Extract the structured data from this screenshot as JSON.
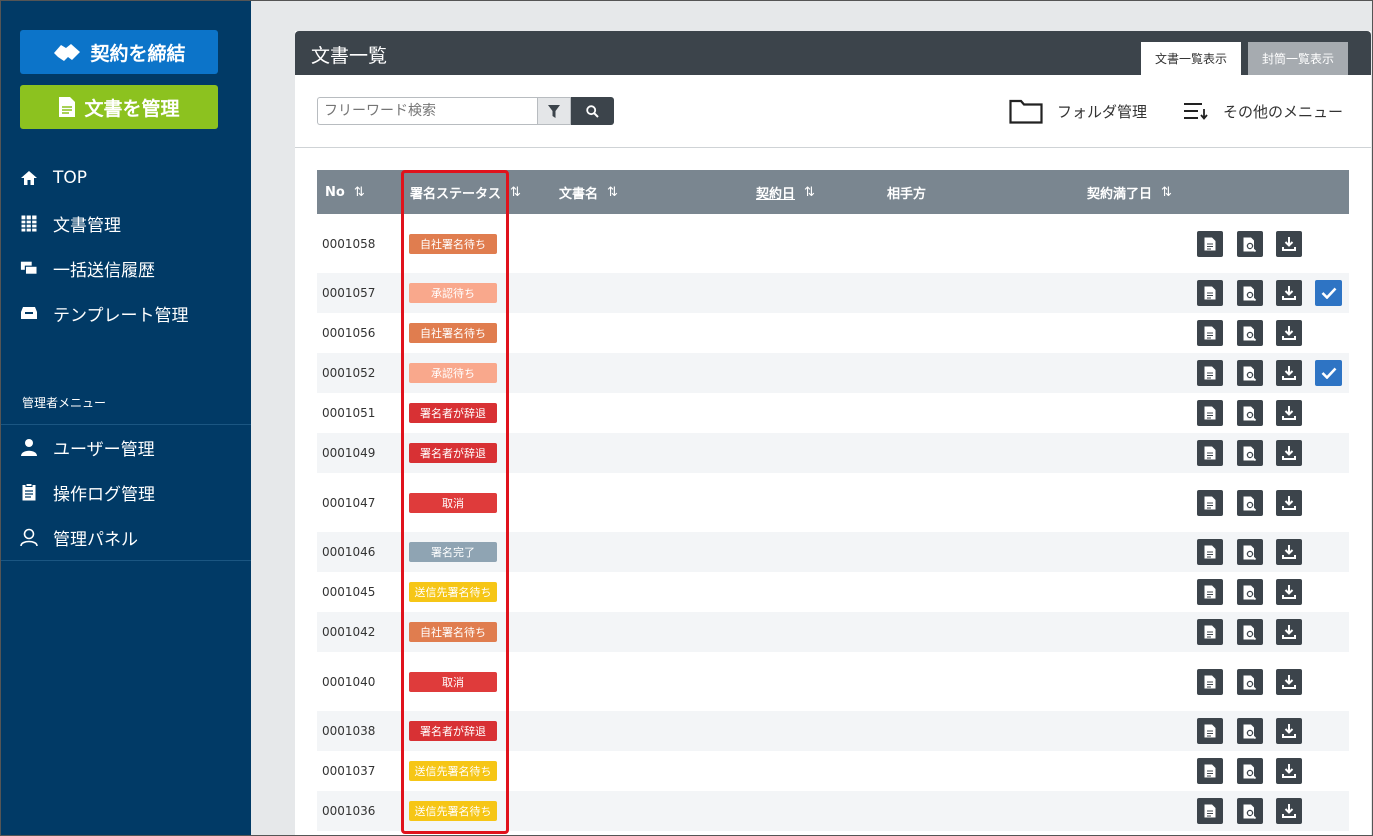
{
  "sidebar": {
    "contract_button": "契約を締結",
    "manage_button": "文書を管理",
    "nav": [
      {
        "label": "TOP",
        "icon": "home-icon"
      },
      {
        "label": "文書管理",
        "icon": "grid-icon"
      },
      {
        "label": "一括送信履歴",
        "icon": "batch-send-icon"
      },
      {
        "label": "テンプレート管理",
        "icon": "template-icon"
      }
    ],
    "admin_title": "管理者メニュー",
    "admin_nav": [
      {
        "label": "ユーザー管理",
        "icon": "user-icon"
      },
      {
        "label": "操作ログ管理",
        "icon": "clipboard-icon"
      },
      {
        "label": "管理パネル",
        "icon": "admin-panel-icon"
      }
    ]
  },
  "panel": {
    "title": "文書一覧",
    "tabs": [
      "文書一覧表示",
      "封筒一覧表示"
    ],
    "search_placeholder": "フリーワード検索",
    "folder_menu": "フォルダ管理",
    "other_menu": "その他のメニュー"
  },
  "table": {
    "headers": [
      "No",
      "署名ステータス",
      "文書名",
      "契約日",
      "相手方",
      "契約満了日"
    ],
    "sort_glyph": "⇅",
    "rows": [
      {
        "no": "0001058",
        "status": "自社署名待ち",
        "color": "#e07d4f",
        "checked": false
      },
      {
        "no": "0001057",
        "status": "承認待ち",
        "color": "#f9a88c",
        "checked": true
      },
      {
        "no": "0001056",
        "status": "自社署名待ち",
        "color": "#e07d4f",
        "checked": false
      },
      {
        "no": "0001052",
        "status": "承認待ち",
        "color": "#f9a88c",
        "checked": true
      },
      {
        "no": "0001051",
        "status": "署名者が辞退",
        "color": "#d83134",
        "checked": false
      },
      {
        "no": "0001049",
        "status": "署名者が辞退",
        "color": "#d83134",
        "checked": false
      },
      {
        "no": "0001047",
        "status": "取消",
        "color": "#df3b3b",
        "checked": false
      },
      {
        "no": "0001046",
        "status": "署名完了",
        "color": "#8fa4b3",
        "checked": false
      },
      {
        "no": "0001045",
        "status": "送信先署名待ち",
        "color": "#f6c616",
        "checked": false
      },
      {
        "no": "0001042",
        "status": "自社署名待ち",
        "color": "#e07d4f",
        "checked": false
      },
      {
        "no": "0001040",
        "status": "取消",
        "color": "#df3b3b",
        "checked": false
      },
      {
        "no": "0001038",
        "status": "署名者が辞退",
        "color": "#d83134",
        "checked": false
      },
      {
        "no": "0001037",
        "status": "送信先署名待ち",
        "color": "#f6c616",
        "checked": false
      },
      {
        "no": "0001036",
        "status": "送信先署名待ち",
        "color": "#f6c616",
        "checked": false
      }
    ]
  }
}
